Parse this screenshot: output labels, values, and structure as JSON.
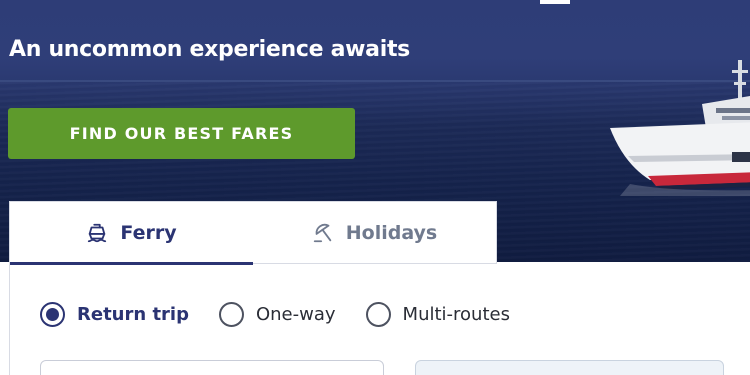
{
  "hero": {
    "tagline": "An uncommon experience awaits",
    "cta_label": "FIND OUR BEST FARES"
  },
  "tabs": [
    {
      "label": "Ferry",
      "icon": "ferry-icon",
      "active": true
    },
    {
      "label": "Holidays",
      "icon": "umbrella-icon",
      "active": false
    }
  ],
  "trip_types": [
    {
      "label": "Return trip",
      "selected": true
    },
    {
      "label": "One-way",
      "selected": false
    },
    {
      "label": "Multi-routes",
      "selected": false
    }
  ],
  "colors": {
    "brand_navy": "#2b3473",
    "cta_green": "#5e9a2c",
    "inactive_tab": "#707a8e"
  }
}
